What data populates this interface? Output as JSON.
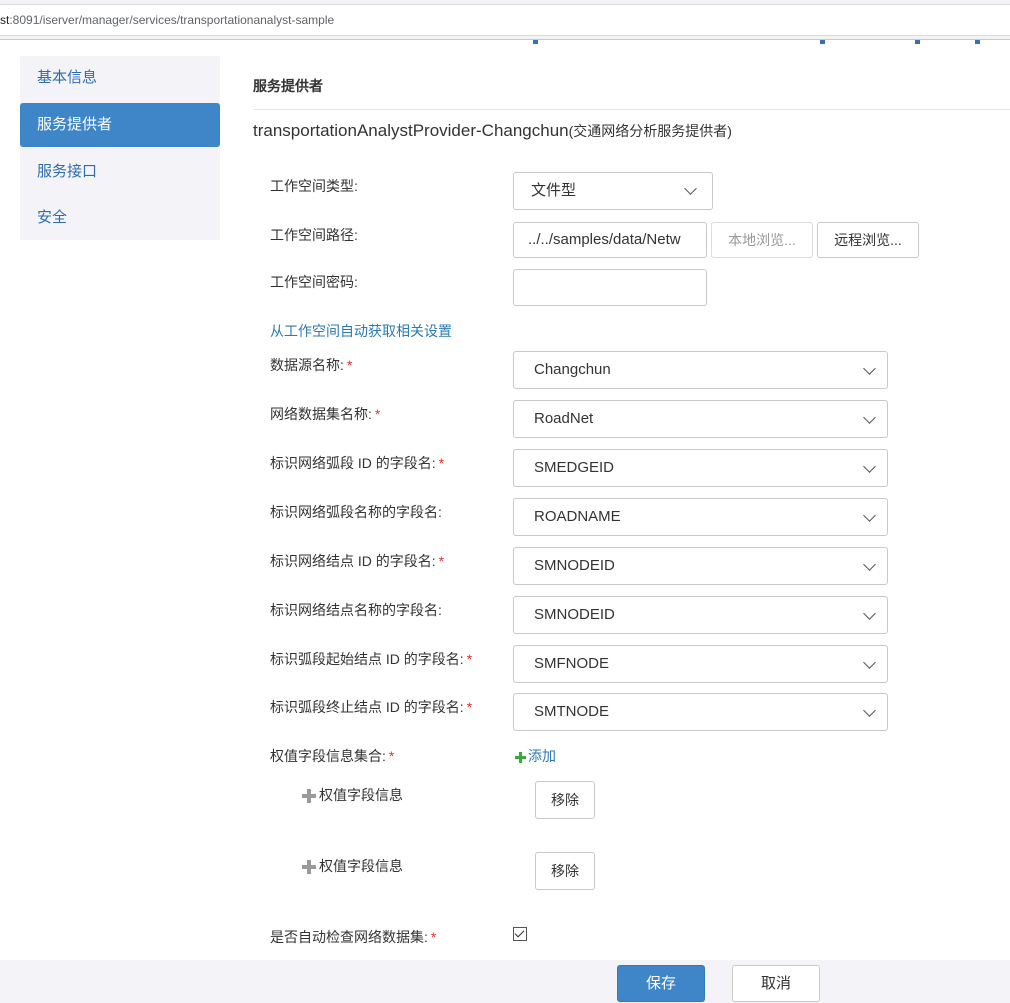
{
  "browser": {
    "url_host": "st",
    "url_rest": ":8091/iserver/manager/services/transportationanalyst-sample"
  },
  "sidebar": {
    "items": [
      {
        "label": "基本信息"
      },
      {
        "label": "服务提供者"
      },
      {
        "label": "服务接口"
      },
      {
        "label": "安全"
      }
    ]
  },
  "section": {
    "title": "服务提供者",
    "provider_name": "transportationAnalystProvider-Changchun",
    "provider_desc": "(交通网络分析服务提供者)"
  },
  "workspace": {
    "type_label": "工作空间类型:",
    "type_value": "文件型",
    "path_label": "工作空间路径:",
    "path_value": "../../samples/data/Netw",
    "local_browse": "本地浏览...",
    "remote_browse": "远程浏览...",
    "password_label": "工作空间密码:",
    "password_value": "",
    "auto_link": "从工作空间自动获取相关设置"
  },
  "fields": [
    {
      "label": "数据源名称:",
      "required": "*",
      "value": "Changchun"
    },
    {
      "label": "网络数据集名称:",
      "required": "*",
      "value": "RoadNet"
    },
    {
      "label": "标识网络弧段 ID 的字段名:",
      "required": "*",
      "value": "SMEDGEID"
    },
    {
      "label": "标识网络弧段名称的字段名:",
      "required": "",
      "value": "ROADNAME"
    },
    {
      "label": "标识网络结点 ID 的字段名:",
      "required": "*",
      "value": "SMNODEID"
    },
    {
      "label": "标识网络结点名称的字段名:",
      "required": "",
      "value": "SMNODEID"
    },
    {
      "label": "标识弧段起始结点 ID 的字段名:",
      "required": "*",
      "value": "SMFNODE"
    },
    {
      "label": "标识弧段终止结点 ID 的字段名:",
      "required": "*",
      "value": "SMTNODE"
    }
  ],
  "weights": {
    "label": "权值字段信息集合:",
    "required": "*",
    "add_label": "添加",
    "items": [
      {
        "label": "权值字段信息",
        "remove": "移除"
      },
      {
        "label": "权值字段信息",
        "remove": "移除"
      }
    ]
  },
  "auto_check": {
    "label": "是否自动检查网络数据集:",
    "required": "*",
    "checked": true
  },
  "footer": {
    "save": "保存",
    "cancel": "取消"
  },
  "colors": {
    "accent": "#3e86c8",
    "link": "#2b7ab6",
    "required": "#e0312f",
    "add_icon": "#3aa83a"
  }
}
